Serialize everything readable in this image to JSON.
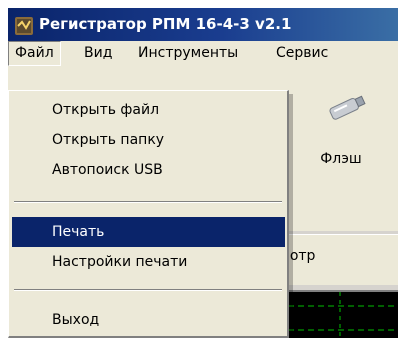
{
  "window": {
    "title": "Регистратор РПМ 16-4-3 v2.1"
  },
  "menu": {
    "items": [
      {
        "label": "Файл"
      },
      {
        "label": "Вид"
      },
      {
        "label": "Инструменты"
      },
      {
        "label": "Сервис"
      }
    ]
  },
  "dropdown": {
    "items": [
      {
        "label": "Открыть файл"
      },
      {
        "label": "Открыть папку"
      },
      {
        "label": "Автопоиск USB"
      },
      {
        "label": "Печать"
      },
      {
        "label": "Настройки печати"
      },
      {
        "label": "Выход"
      }
    ]
  },
  "toolbar": {
    "flash_label": "Флэш"
  },
  "tabs": {
    "preview_label": "осмотр"
  },
  "colors": {
    "title_bar": "#0a246a",
    "highlight": "#0a246a",
    "menu_bg": "#ece9d8",
    "chart_grid": "#00c000"
  },
  "icons": {
    "app": "app-icon",
    "flash": "usb-flash-drive-icon"
  }
}
